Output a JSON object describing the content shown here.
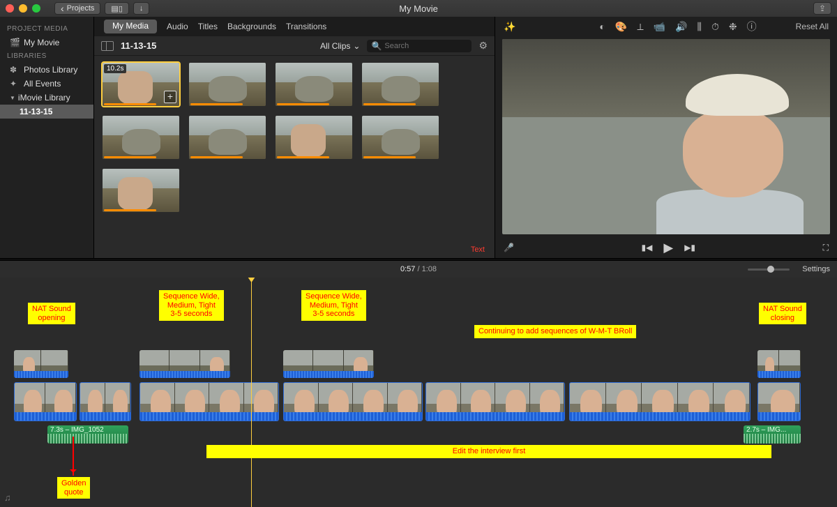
{
  "titlebar": {
    "title": "My Movie",
    "back": "Projects"
  },
  "sidebar": {
    "section1": "PROJECT MEDIA",
    "item_movie": "My Movie",
    "section2": "LIBRARIES",
    "item_photos": "Photos Library",
    "item_all": "All Events",
    "item_lib": "iMovie Library",
    "item_event": "11-13-15"
  },
  "tabs": {
    "mymedia": "My Media",
    "audio": "Audio",
    "titles": "Titles",
    "backgrounds": "Backgrounds",
    "transitions": "Transitions"
  },
  "browser": {
    "title": "11-13-15",
    "filter": "All Clips",
    "search_ph": "Search",
    "clip_dur": "10.2s",
    "text_label": "Text"
  },
  "viewer": {
    "reset": "Reset All"
  },
  "timeline": {
    "current": "0:57",
    "total": "1:08",
    "settings": "Settings",
    "audio1": "7.3s – IMG_1052",
    "audio2": "2.7s – IMG..."
  },
  "notes": {
    "nat_open": "NAT Sound\nopening",
    "seq1": "Sequence Wide,\nMedium, Tight\n3-5 seconds",
    "seq2": "Sequence Wide,\nMedium, Tight\n3-5 seconds",
    "continuing": "Continuing to add sequences of W-M-T BRoll",
    "nat_close": "NAT Sound\nclosing",
    "edit_first": "Edit the interview first",
    "golden": "Golden\nquote"
  }
}
